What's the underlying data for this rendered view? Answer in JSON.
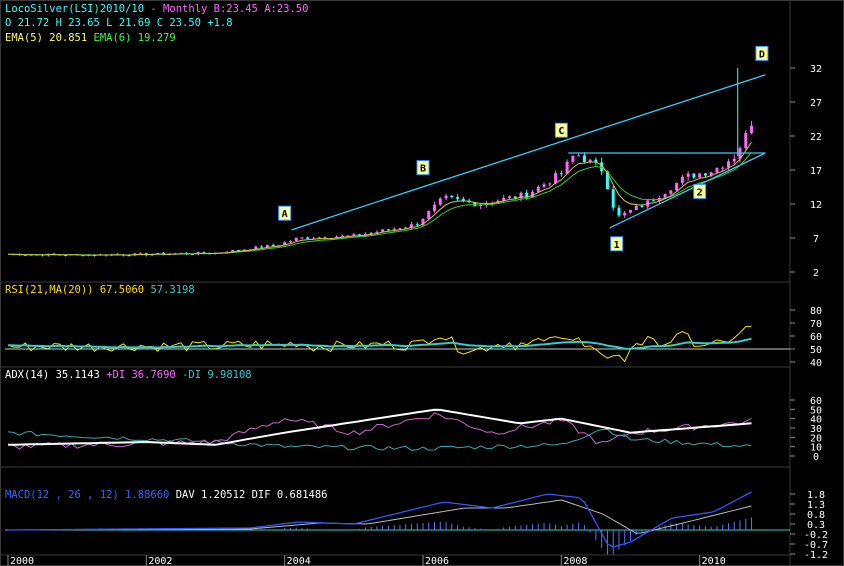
{
  "header": {
    "line1_title": "LocoSilver(LSI)2010/10",
    "line1_info": "- Monthly B:23.45 A:23.50",
    "line2": "O 21.72 H 23.65 L 21.69 C 23.50  +1.8",
    "line3_ema5": "EMA(5) 20.851",
    "line3_ema6": "EMA(6) 19.279"
  },
  "panels": {
    "rsi": {
      "label": "RSI(21,MA(20))",
      "v1": "67.5060",
      "v2": "57.3198"
    },
    "adx": {
      "label": "ADX(14)",
      "v1": "35.1143",
      "pdi_label": "+DI",
      "pdi": "36.7690",
      "mdi_label": "-DI",
      "mdi": "9.98108"
    },
    "macd": {
      "label": "MACD(12 , 26 , 12)",
      "v1": "1.88660",
      "dav_label": "DAV",
      "dav": "1.20512",
      "dif_label": "DIF",
      "dif": "0.681486"
    }
  },
  "colors": {
    "background": "#000000",
    "up_candle": "#ff66ff",
    "down_candle": "#33ffff",
    "ema5": "#ffff66",
    "ema6": "#33cc33",
    "trendline": "#33ccff",
    "rsi": "#ffdd00",
    "rsi_ma": "#33cccc",
    "adx": "#ffffff",
    "plus_di": "#cc66cc",
    "minus_di": "#33aaaa",
    "macd": "#3355ff",
    "dav": "#bbbbbb",
    "hist": "#5577ff"
  },
  "annotations": [
    "A",
    "B",
    "C",
    "D",
    "1",
    "2"
  ],
  "chart_data": [
    {
      "type": "candlestick",
      "title": "LocoSilver(LSI)2010/10",
      "x_tick_labels": [
        "2000",
        "2002",
        "2004",
        "2006",
        "2008",
        "2010"
      ],
      "y_ticks": [
        2,
        7,
        12,
        17,
        22,
        27,
        32
      ],
      "ylim": [
        0,
        35
      ],
      "series": [
        {
          "name": "close",
          "x": [
            "2000",
            "2001",
            "2002",
            "2003",
            "2004",
            "2005",
            "2006",
            "2007",
            "2008",
            "2008.5",
            "2009",
            "2010",
            "2010.5",
            "2010.8"
          ],
          "values": [
            4.6,
            4.5,
            4.6,
            4.8,
            6.8,
            7.3,
            12.9,
            13.4,
            19.5,
            10.0,
            13.5,
            17.5,
            19.0,
            23.5
          ]
        }
      ],
      "last_bar": {
        "open": 21.72,
        "high": 23.65,
        "low": 21.69,
        "close": 23.5
      },
      "grid": false
    },
    {
      "type": "line",
      "title": "RSI(21,MA(20))",
      "y_ticks": [
        40,
        50,
        60,
        70,
        80
      ],
      "series": [
        {
          "name": "RSI",
          "last": 67.506
        },
        {
          "name": "MA",
          "last": 57.3198
        }
      ]
    },
    {
      "type": "line",
      "title": "ADX(14)",
      "y_ticks": [
        0,
        10,
        20,
        30,
        40,
        50,
        60
      ],
      "series": [
        {
          "name": "ADX",
          "last": 35.1143
        },
        {
          "name": "+DI",
          "last": 36.769
        },
        {
          "name": "-DI",
          "last": 9.98108
        }
      ]
    },
    {
      "type": "line",
      "title": "MACD(12 , 26 , 12)",
      "y_ticks": [
        "1.8",
        "1.3",
        "0.8",
        "0.3",
        "-0.2",
        "-0.7",
        "-1.2"
      ],
      "series": [
        {
          "name": "MACD",
          "last": 1.8866
        },
        {
          "name": "DAV",
          "last": 1.20512
        },
        {
          "name": "DIF",
          "last": 0.681486
        }
      ]
    }
  ]
}
